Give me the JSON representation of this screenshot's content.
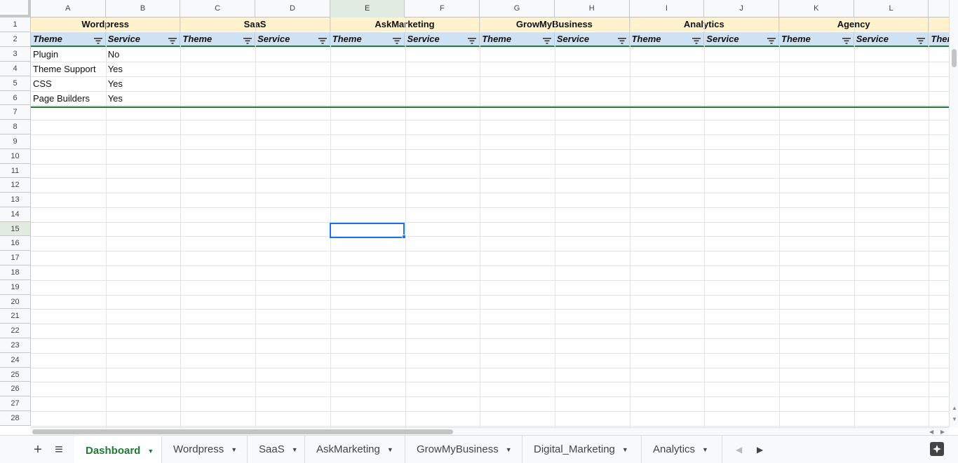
{
  "columns": [
    "A",
    "B",
    "C",
    "D",
    "E",
    "F",
    "G",
    "H",
    "I",
    "J",
    "K",
    "L"
  ],
  "row_numbers": [
    "1",
    "2",
    "3",
    "4",
    "5",
    "6",
    "7",
    "8",
    "9",
    "10",
    "11",
    "12",
    "13",
    "14",
    "15",
    "16",
    "17",
    "18",
    "19",
    "20",
    "21",
    "22",
    "23",
    "24",
    "25",
    "26",
    "27",
    "28"
  ],
  "group_headers": [
    "Wordpress",
    "SaaS",
    "AskMarketing",
    "GrowMyBusiness",
    "Analytics",
    "Agency"
  ],
  "sub_headers": {
    "theme": "Theme",
    "service": "Service",
    "overflow": "Ther"
  },
  "rows": [
    {
      "theme": "Plugin",
      "service": "No"
    },
    {
      "theme": "Theme Support",
      "service": "Yes"
    },
    {
      "theme": "CSS",
      "service": "Yes"
    },
    {
      "theme": "Page Builders",
      "service": "Yes"
    }
  ],
  "selected_cell": {
    "column": "E",
    "row": "15"
  },
  "sheet_tabs": [
    {
      "label": "Dashboard",
      "active": true
    },
    {
      "label": "Wordpress",
      "active": false
    },
    {
      "label": "SaaS",
      "active": false
    },
    {
      "label": "AskMarketing",
      "active": false
    },
    {
      "label": "GrowMyBusiness",
      "active": false
    },
    {
      "label": "Digital_Marketing",
      "active": false
    },
    {
      "label": "Analytics",
      "active": false
    }
  ],
  "toolbar": {
    "add_sheet_symbol": "+",
    "all_sheets_symbol": "≡"
  },
  "colors": {
    "group_header_bg": "#fff2cc",
    "sub_header_bg": "#cfe2f3",
    "freeze_line": "#1e7b34",
    "selection": "#1a73e8",
    "active_tab": "#1e7b34"
  },
  "icons": {
    "add_sheet": "plus-icon",
    "all_sheets": "list-icon",
    "filter": "filter-icon",
    "explore": "explore-icon"
  }
}
